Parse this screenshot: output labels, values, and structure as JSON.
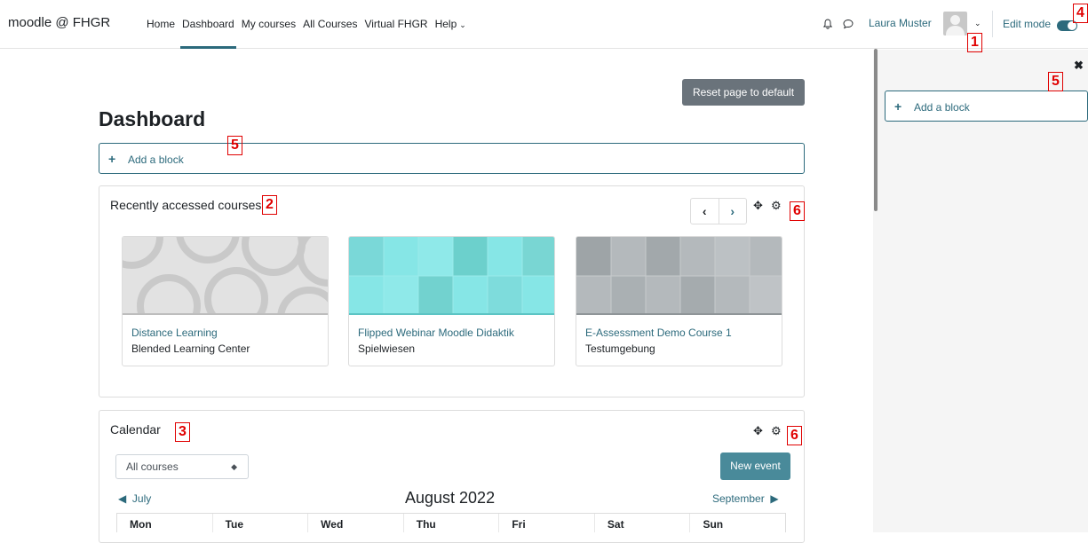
{
  "brand": "moodle @ FHGR",
  "nav": {
    "items": [
      {
        "label": "Home"
      },
      {
        "label": "Dashboard"
      },
      {
        "label": "My courses"
      },
      {
        "label": "All Courses"
      },
      {
        "label": "Virtual FHGR"
      },
      {
        "label": "Help"
      }
    ],
    "active": "Dashboard"
  },
  "user": {
    "name": "Laura Muster"
  },
  "edit_mode": {
    "label": "Edit mode",
    "enabled": true
  },
  "callouts": [
    "1",
    "2",
    "3",
    "4",
    "5",
    "5",
    "6",
    "6"
  ],
  "main": {
    "reset_label": "Reset page to default",
    "title": "Dashboard",
    "add_block_label": "Add a block"
  },
  "recent": {
    "title": "Recently accessed courses",
    "courses": [
      {
        "name": "Distance Learning",
        "category": "Blended Learning Center"
      },
      {
        "name": "Flipped Webinar Moodle Didaktik",
        "category": "Spielwiesen"
      },
      {
        "name": "E-Assessment Demo Course 1",
        "category": "Testumgebung"
      }
    ]
  },
  "calendar": {
    "title": "Calendar",
    "filter_value": "All courses",
    "new_event_label": "New event",
    "prev_month": "July",
    "month": "August 2022",
    "next_month": "September",
    "days": [
      "Mon",
      "Tue",
      "Wed",
      "Thu",
      "Fri",
      "Sat",
      "Sun"
    ]
  },
  "drawer": {
    "add_block_label": "Add a block"
  },
  "colors": {
    "accent": "#2c6a7c",
    "callout": "#e00000"
  }
}
